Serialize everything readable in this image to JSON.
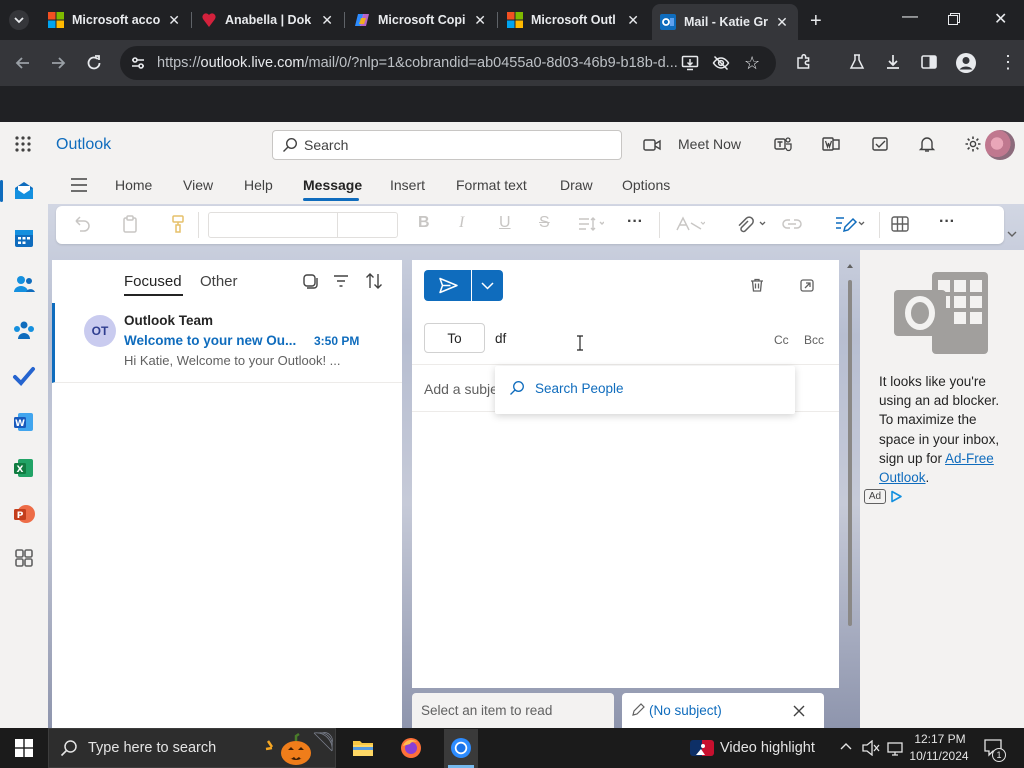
{
  "browser": {
    "tabs": [
      {
        "label": "Microsoft acco",
        "icon": "microsoft-logo-icon"
      },
      {
        "label": "Anabella | Dok",
        "icon": "dokter-heart-icon"
      },
      {
        "label": "Microsoft Copi",
        "icon": "copilot-icon"
      },
      {
        "label": "Microsoft Outl",
        "icon": "microsoft-logo-icon"
      },
      {
        "label": "Mail - Katie Gr",
        "icon": "outlook-icon",
        "active": true
      }
    ],
    "url_prefix": "https://",
    "url_host": "outlook.live.com",
    "url_path": "/mail/0/?nlp=1&cobrandid=ab0455a0-8d03-46b9-b18b-d..."
  },
  "outlook": {
    "brand": "Outlook",
    "search_placeholder": "Search",
    "meet_now": "Meet Now"
  },
  "ribbon": {
    "tabs": [
      "Home",
      "View",
      "Help",
      "Message",
      "Insert",
      "Format text",
      "Draw",
      "Options"
    ],
    "selected_tab": "Message"
  },
  "message_list": {
    "pivot_focused": "Focused",
    "pivot_other": "Other",
    "items": [
      {
        "avatar_initials": "OT",
        "from": "Outlook Team",
        "subject": "Welcome to your new Ou...",
        "time": "3:50 PM",
        "preview": "Hi Katie, Welcome to your Outlook! ..."
      }
    ]
  },
  "compose": {
    "to_label": "To",
    "to_value": "df",
    "cc_label": "Cc",
    "bcc_label": "Bcc",
    "subject_placeholder": "Add a subject",
    "people_dropdown_label": "Search People"
  },
  "ad": {
    "text_before_link": "It looks like you're using an ad blocker. To maximize the space in your inbox, sign up for ",
    "link_text": "Ad-Free Outlook",
    "text_after_link": ".",
    "badge": "Ad"
  },
  "bottom_tabs": {
    "select_item": "Select an item to read",
    "draft": "(No subject)"
  },
  "taskbar": {
    "search_label": "Type here to search",
    "video_highlight": "Video highlight",
    "time": "12:17 PM",
    "date": "10/11/2024",
    "notification_count": "1"
  },
  "colors": {
    "accent": "#0f6cbd",
    "chrome_dark": "#202124",
    "chrome_tab": "#35363a"
  }
}
